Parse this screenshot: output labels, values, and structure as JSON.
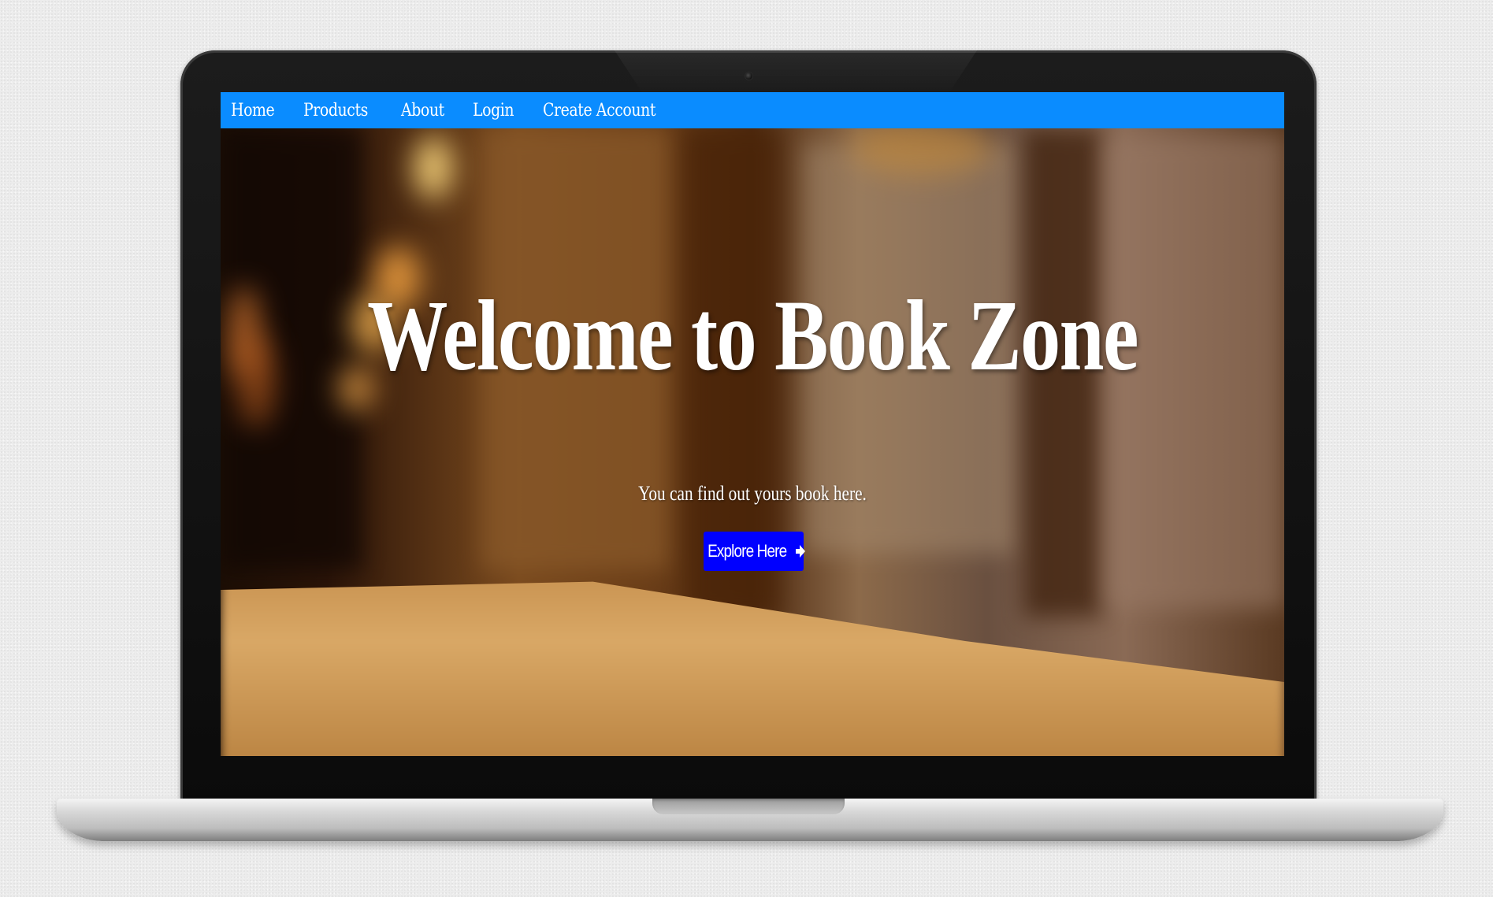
{
  "navbar": {
    "links": [
      {
        "label": "Home"
      },
      {
        "label": "Products"
      },
      {
        "label": "About"
      },
      {
        "label": "Login"
      },
      {
        "label": "Create Account"
      }
    ]
  },
  "hero": {
    "title": "Welcome to Book Zone",
    "subtitle": "You can find out yours book here.",
    "button_label": "Explore Here",
    "button_icon": "arrow-right-icon"
  },
  "colors": {
    "navbar_bg": "#0a8cff",
    "button_bg": "#0000ff",
    "text": "#ffffff"
  }
}
